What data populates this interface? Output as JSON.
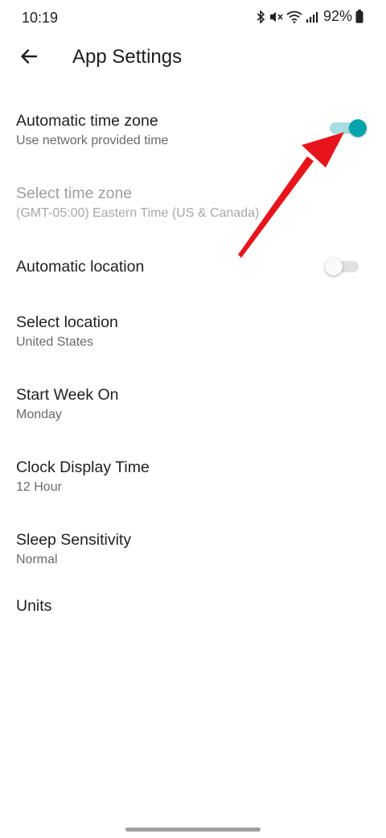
{
  "status_bar": {
    "time": "10:19",
    "battery": "92%",
    "icons": [
      "bluetooth-icon",
      "mute-icon",
      "wifi-icon",
      "signal-icon",
      "battery-icon"
    ]
  },
  "header": {
    "back_icon": "arrow-left-icon",
    "title": "App Settings"
  },
  "settings": {
    "auto_timezone": {
      "title": "Automatic time zone",
      "subtitle": "Use network provided time",
      "enabled": true
    },
    "select_timezone": {
      "title": "Select time zone",
      "subtitle": "(GMT-05:00) Eastern Time (US & Canada)",
      "disabled": true
    },
    "auto_location": {
      "title": "Automatic location",
      "enabled": false
    },
    "select_location": {
      "title": "Select location",
      "subtitle": "United States"
    },
    "start_week": {
      "title": "Start Week On",
      "subtitle": "Monday"
    },
    "clock_display": {
      "title": "Clock Display Time",
      "subtitle": "12 Hour"
    },
    "sleep_sensitivity": {
      "title": "Sleep Sensitivity",
      "subtitle": "Normal"
    },
    "units": {
      "title": "Units"
    }
  },
  "colors": {
    "accent": "#00a4ad",
    "accent_track": "#a6dde0",
    "annotation_arrow": "#e8141c"
  }
}
